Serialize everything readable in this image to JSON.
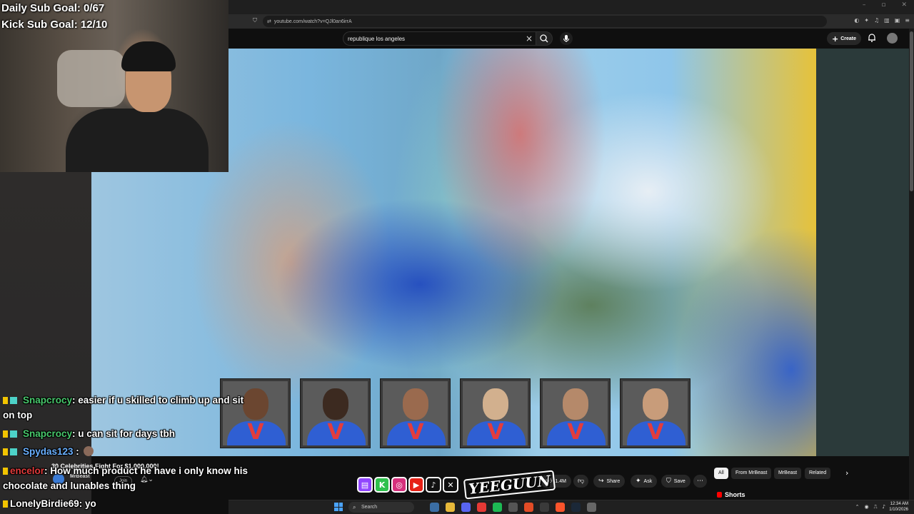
{
  "stream_overlay": {
    "daily_sub_goal": "Daily Sub Goal: 0/67",
    "kick_sub_goal": "Kick Sub Goal: 12/10"
  },
  "browser": {
    "url": "youtube.com/watch?v=QJl0an6irrA",
    "window_controls": [
      "–",
      "▫",
      "✕"
    ]
  },
  "youtube": {
    "search_value": "republique los angeles",
    "create_label": "Create",
    "video_title": "30 Celebrities Fight For $1,000,000!",
    "channel_name": "MrBeast",
    "join_label": "Join",
    "like_count": "1.4M",
    "share_label": "Share",
    "ask_label": "Ask",
    "save_label": "Save",
    "chips": [
      "All",
      "From MrBeast",
      "MrBeast",
      "Related"
    ],
    "shorts_label": "Shorts"
  },
  "chat": [
    {
      "user": "Snapcrocy",
      "color": "#48c86c",
      "message": ": easier if u skilled to climb up and sit",
      "continuation": "on top"
    },
    {
      "user": "Snapcrocy",
      "color": "#48c86c",
      "message": ": u can sit for days tbh"
    },
    {
      "user": "Spydas123",
      "color": "#6ab0ff",
      "message": " :"
    },
    {
      "user": "encelor",
      "color": "#e23b3b",
      "message": ": How much product he have i only know his",
      "continuation": "chocolate and lunables thing"
    },
    {
      "user": "LonelyBirdie69",
      "color": "#ffffff",
      "message": ": yo"
    }
  ],
  "socials": [
    "twitch",
    "kick",
    "instagram",
    "youtube",
    "tiktok",
    "x"
  ],
  "socials_logo": "YEEGUUN",
  "taskbar": {
    "search_label": "Search",
    "time": "12:34 AM",
    "date": "1/10/2026"
  },
  "colors": {
    "youtube_bg": "#0f0f0f",
    "chip_active": "#f1f1f1",
    "shirt_blue": "#2f5fd3",
    "logo_red": "#e43c3c"
  }
}
